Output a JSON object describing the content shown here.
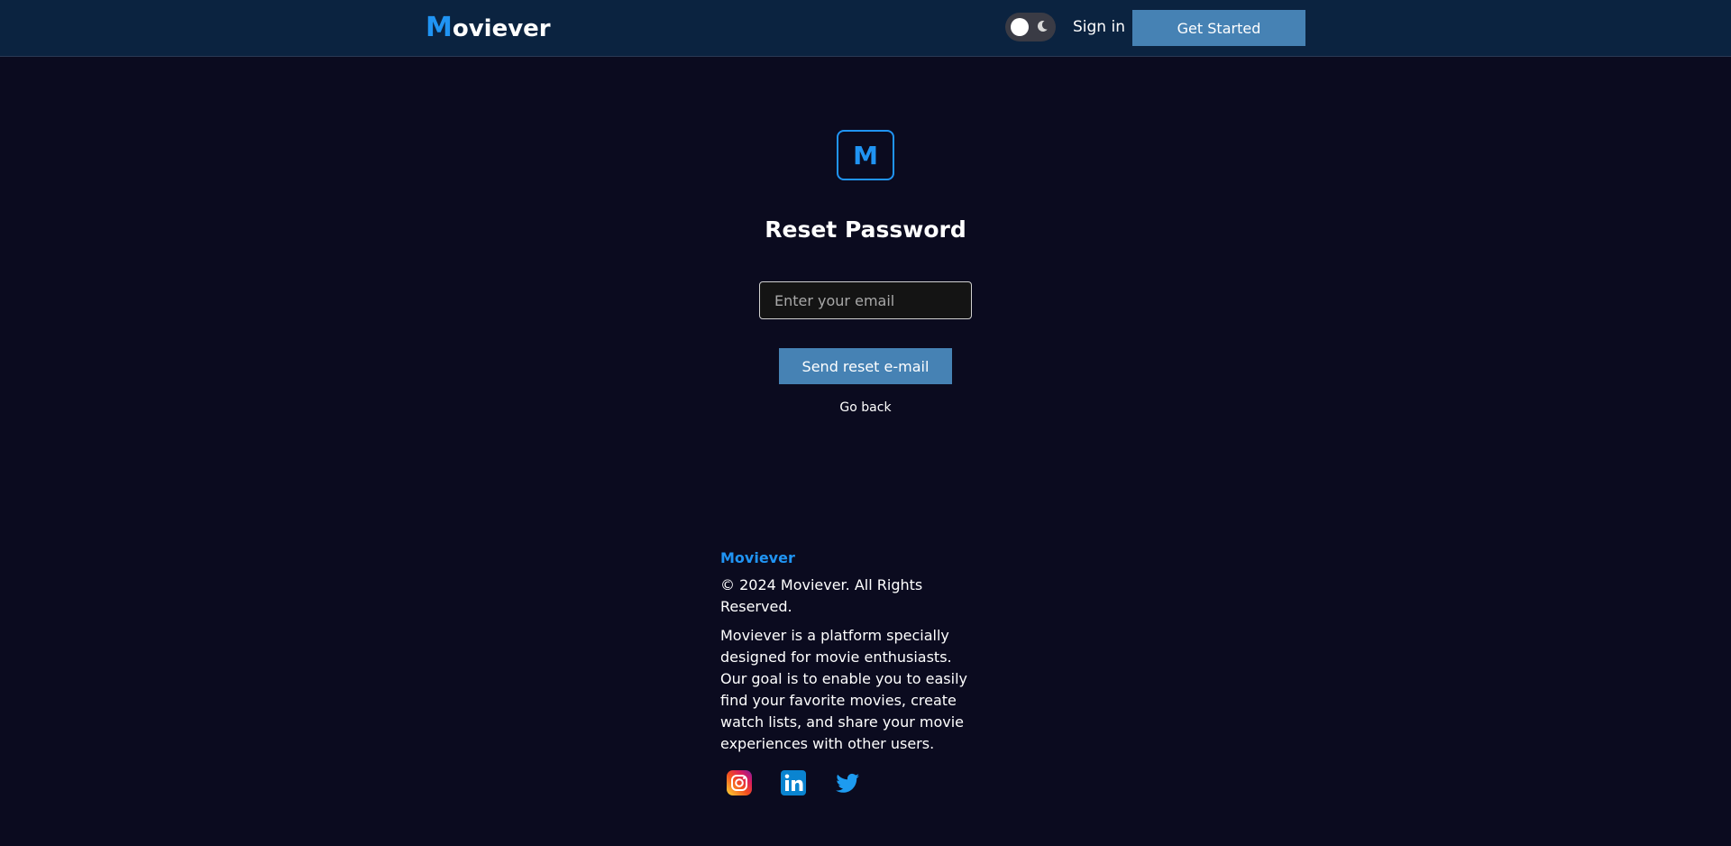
{
  "header": {
    "logo_initial": "M",
    "logo_rest": "oviever",
    "signin_label": "Sign in",
    "get_started_label": "Get Started",
    "theme_mode": "dark"
  },
  "reset": {
    "badge_letter": "M",
    "title": "Reset Password",
    "email_placeholder": "Enter your email",
    "email_value": "",
    "send_label": "Send reset e-mail",
    "go_back_label": "Go back"
  },
  "footer": {
    "brand": "Moviever",
    "copyright": "© 2024 Moviever. All Rights Reserved.",
    "description": "Moviever is a platform specially designed for movie enthusiasts. Our goal is to enable you to easily find your favorite movies, create watch lists, and share your movie experiences with other users.",
    "socials": [
      "instagram-icon",
      "linkedin-icon",
      "twitter-icon"
    ]
  },
  "colors": {
    "accent": "#2094f3",
    "button": "#4682b4",
    "header_bg": "#0b2340",
    "page_bg": "#0b0b1f"
  }
}
